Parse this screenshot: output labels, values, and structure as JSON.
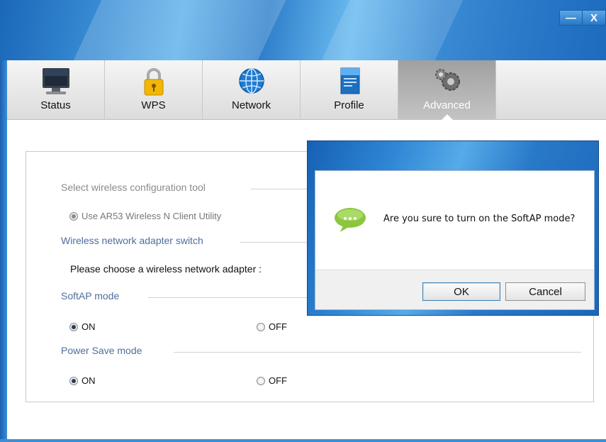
{
  "window": {
    "minimize_label": "—",
    "close_label": "X"
  },
  "tabs": [
    {
      "label": "Status",
      "icon": "monitor-icon",
      "active": false
    },
    {
      "label": "WPS",
      "icon": "padlock-icon",
      "active": false
    },
    {
      "label": "Network",
      "icon": "globe-icon",
      "active": false
    },
    {
      "label": "Profile",
      "icon": "profile-document-icon",
      "active": false
    },
    {
      "label": "Advanced",
      "icon": "gears-icon",
      "active": true
    }
  ],
  "panel": {
    "config_tool": {
      "title": "Select wireless configuration tool",
      "option": "Use AR53 Wireless N Client Utility"
    },
    "adapter_switch": {
      "title": "Wireless network adapter switch",
      "prompt": "Please choose a wireless network adapter :"
    },
    "softap": {
      "title": "SoftAP mode",
      "on_label": "ON",
      "off_label": "OFF",
      "selected": "ON"
    },
    "power_save": {
      "title": "Power Save mode",
      "on_label": "ON",
      "off_label": "OFF",
      "selected": "ON"
    }
  },
  "dialog": {
    "message": "Are you sure to turn on the SoftAP mode?",
    "icon": "speech-bubble-icon",
    "ok_label": "OK",
    "cancel_label": "Cancel"
  },
  "colors": {
    "title_bar": "#2f7fcb",
    "section_title": "#4d6f9c",
    "bubble_icon": "#8cc63f"
  }
}
